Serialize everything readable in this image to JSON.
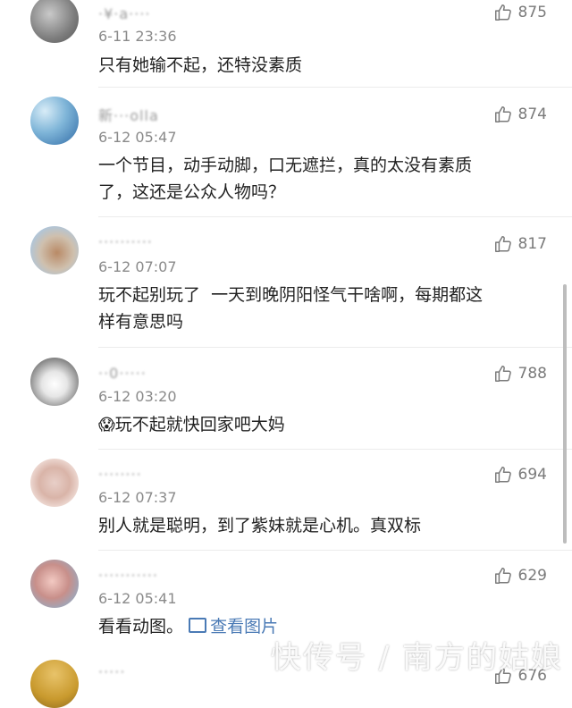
{
  "comments": [
    {
      "username": "·¥·a····",
      "time": "6-11 23:36",
      "likes": "875",
      "text": "只有她输不起，还特没素质"
    },
    {
      "username": "新···olla",
      "time": "6-12 05:47",
      "likes": "874",
      "text": "一个节目，动手动脚，口无遮拦，真的太没有素质\n了，这还是公众人物吗？"
    },
    {
      "username": "··········",
      "time": "6-12 07:07",
      "likes": "817",
      "text": "玩不起别玩了  一天到晚阴阳怪气干啥啊，每期都这\n样有意思吗"
    },
    {
      "username": "··0·····",
      "time": "6-12 03:20",
      "likes": "788",
      "text": "玩不起就快回家吧大妈",
      "emoji": "😱"
    },
    {
      "username": "········",
      "time": "6-12 07:37",
      "likes": "694",
      "text": "别人就是聪明，到了紫妹就是心机。真双标"
    },
    {
      "username": "···········",
      "time": "6-12 05:41",
      "likes": "629",
      "text": "看看动图。",
      "image_link": "查看图片"
    },
    {
      "username": "·····",
      "time": "",
      "likes": "676",
      "text": ""
    }
  ],
  "watermark": "快传号 / 南方的姑娘",
  "colors": {
    "link": "#4a7ab5",
    "meta": "#8a8a8a",
    "text": "#222222"
  },
  "icons": {
    "like": "thumbs-up-icon",
    "picture": "picture-icon"
  }
}
